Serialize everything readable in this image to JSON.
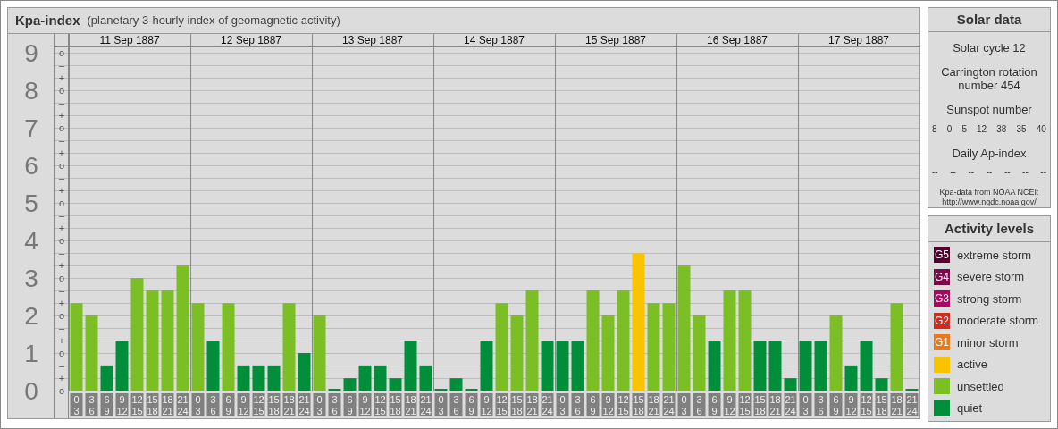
{
  "title": {
    "name": "Kpa-index",
    "subtitle": "(planetary 3-hourly index of geomagnetic activity)"
  },
  "days": [
    "11 Sep 1887",
    "12 Sep 1887",
    "13 Sep 1887",
    "14 Sep 1887",
    "15 Sep 1887",
    "16 Sep 1887",
    "17 Sep 1887"
  ],
  "y_minor_ticks": [
    "o",
    "–",
    "+",
    "o",
    "–",
    "+",
    "o",
    "–",
    "+",
    "o",
    "–",
    "+",
    "o",
    "–",
    "+",
    "o",
    "–",
    "+",
    "o",
    "–",
    "+",
    "o",
    "–",
    "+",
    "o",
    "–",
    "+",
    "o"
  ],
  "chart_data": {
    "type": "bar",
    "grid": true,
    "ylim": [
      0,
      9.17
    ],
    "yticks": [
      {
        "value": 0,
        "label": "0"
      },
      {
        "value": 1,
        "label": "1"
      },
      {
        "value": 2,
        "label": "2"
      },
      {
        "value": 3,
        "label": "3"
      },
      {
        "value": 4,
        "label": "4"
      },
      {
        "value": 5,
        "label": "5"
      },
      {
        "value": 6,
        "label": "6"
      },
      {
        "value": 7,
        "label": "7"
      },
      {
        "value": 8,
        "label": "8"
      },
      {
        "value": 9,
        "label": "9"
      }
    ],
    "categories": [
      "0 3",
      "3 6",
      "6 9",
      "9 12",
      "12 15",
      "15 18",
      "18 21",
      "21 24",
      "0 3",
      "3 6",
      "6 9",
      "9 12",
      "12 15",
      "15 18",
      "18 21",
      "21 24",
      "0 3",
      "3 6",
      "6 9",
      "9 12",
      "12 15",
      "15 18",
      "18 21",
      "21 24",
      "0 3",
      "3 6",
      "6 9",
      "9 12",
      "12 15",
      "15 18",
      "18 21",
      "21 24",
      "0 3",
      "3 6",
      "6 9",
      "9 12",
      "12 15",
      "15 18",
      "18 21",
      "21 24",
      "0 3",
      "3 6",
      "6 9",
      "9 12",
      "12 15",
      "15 18",
      "18 21",
      "21 24",
      "0 3",
      "3 6",
      "6 9",
      "9 12",
      "12 15",
      "15 18",
      "18 21",
      "21 24"
    ],
    "series": [
      {
        "color": "#008e3a",
        "values": [
          null,
          null,
          0.67,
          1.33,
          null,
          null,
          null,
          null,
          null,
          1.33,
          null,
          0.67,
          0.67,
          0.67,
          null,
          1,
          null,
          0,
          0.33,
          0.67,
          0.67,
          0.33,
          1.33,
          0.67,
          0,
          0.33,
          0,
          1.33,
          null,
          null,
          null,
          1.33,
          1.33,
          1.33,
          null,
          null,
          null,
          null,
          null,
          null,
          null,
          null,
          1.33,
          null,
          null,
          1.33,
          1.33,
          0.33,
          1.33,
          1.33,
          null,
          0.67,
          1.33,
          0.33,
          null,
          0
        ]
      },
      {
        "color": "#7bbf24",
        "values": [
          2.33,
          2,
          null,
          null,
          3,
          2.67,
          2.67,
          3.33,
          2.33,
          null,
          2.33,
          null,
          null,
          null,
          2.33,
          null,
          2,
          null,
          null,
          null,
          null,
          null,
          null,
          null,
          null,
          null,
          null,
          null,
          2.33,
          2,
          2.67,
          null,
          null,
          null,
          2.67,
          2,
          2.67,
          null,
          2.33,
          2.33,
          3.33,
          2,
          null,
          2.67,
          2.67,
          null,
          null,
          null,
          null,
          null,
          2,
          null,
          null,
          null,
          2.33,
          null
        ]
      },
      {
        "color": "#f8c400",
        "values": [
          null,
          null,
          null,
          null,
          null,
          null,
          null,
          null,
          null,
          null,
          null,
          null,
          null,
          null,
          null,
          null,
          null,
          null,
          null,
          null,
          null,
          null,
          null,
          null,
          null,
          null,
          null,
          null,
          null,
          null,
          null,
          null,
          null,
          null,
          null,
          null,
          null,
          3.67,
          null,
          null,
          null,
          null,
          null,
          null,
          null,
          null,
          null,
          null,
          null,
          null,
          null,
          null,
          null,
          null,
          null,
          null
        ]
      }
    ]
  },
  "solar": {
    "title": "Solar data",
    "cycle": "Solar cycle 12",
    "rotation": "Carrington rotation number 454",
    "sunspot_label": "Sunspot number",
    "sunspots": [
      "8",
      "0",
      "5",
      "12",
      "38",
      "35",
      "40"
    ],
    "ap_label": "Daily Ap-index",
    "ap": [
      "--",
      "--",
      "--",
      "--",
      "--",
      "--",
      "--"
    ],
    "source": "Kpa-data from NOAA NCEI:",
    "source_url": "http://www.ngdc.noaa.gov/"
  },
  "legend": {
    "title": "Activity levels",
    "items": [
      {
        "code": "G5",
        "label": "extreme storm",
        "color": "#57002e"
      },
      {
        "code": "G4",
        "label": "severe storm",
        "color": "#7a0a45"
      },
      {
        "code": "G3",
        "label": "strong storm",
        "color": "#a8085e"
      },
      {
        "code": "G2",
        "label": "moderate storm",
        "color": "#d42a1c"
      },
      {
        "code": "G1",
        "label": "minor storm",
        "color": "#e8781a"
      },
      {
        "label": "active",
        "color": "#f8c400"
      },
      {
        "label": "unsettled",
        "color": "#7bbf24"
      },
      {
        "label": "quiet",
        "color": "#008e3a"
      }
    ]
  }
}
